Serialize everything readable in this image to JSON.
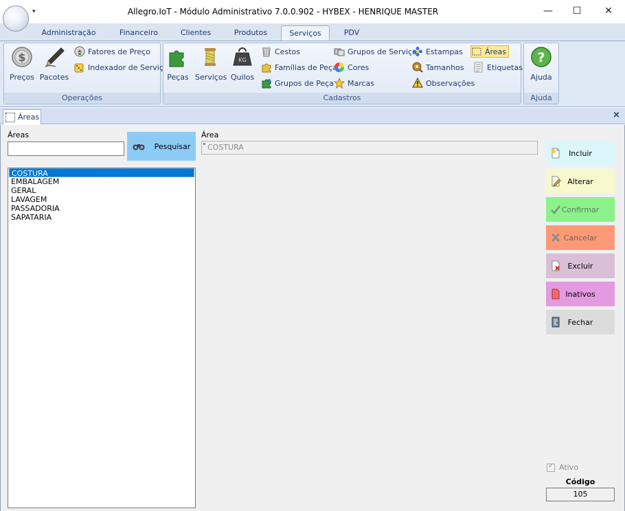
{
  "window": {
    "title": "Allegro.IoT - Módulo Administrativo 7.0.0.902 - HYBEX - HENRIQUE MASTER",
    "minimize": "—",
    "maximize": "☐",
    "close": "✕"
  },
  "ribbon": {
    "tabs": [
      {
        "label": "Administração"
      },
      {
        "label": "Financeiro"
      },
      {
        "label": "Clientes"
      },
      {
        "label": "Produtos"
      },
      {
        "label": "Serviços"
      },
      {
        "label": "PDV"
      }
    ],
    "active_tab": "Serviços",
    "groups": {
      "operacoes": {
        "label": "Operações",
        "precos": "Preços",
        "pacotes": "Pacotes",
        "fatores": "Fatores de Preço",
        "indexador": "Indexador de Serviço"
      },
      "cadastros": {
        "label": "Cadastros",
        "pecas": "Peças",
        "servicos": "Serviços",
        "quilos": "Quilos",
        "cestos": "Cestos",
        "familias": "Famílias de Peça",
        "grupos_peca": "Grupos de Peça",
        "grupos_servico": "Grupos de Serviço",
        "cores": "Cores",
        "marcas": "Marcas",
        "estampas": "Estampas",
        "tamanhos": "Tamanhos",
        "observacoes": "Observações",
        "areas": "Áreas",
        "etiquetas": "Etiquetas"
      },
      "ajuda": {
        "label": "Ajuda",
        "ajuda": "Ajuda"
      }
    }
  },
  "document": {
    "tab_label": "Áreas",
    "close": "×"
  },
  "form": {
    "search_label": "Áreas",
    "search_value": "",
    "search_button": "Pesquisar",
    "area_label": "Área",
    "area_value": "COSTURA",
    "list": [
      "COSTURA",
      "EMBALAGEM",
      "GERAL",
      "LAVAGEM",
      "PASSADORIA",
      "SAPATARIA"
    ],
    "selected_index": 0
  },
  "actions": {
    "incluir": "Incluir",
    "alterar": "Alterar",
    "confirmar": "Confirmar",
    "cancelar": "Cancelar",
    "excluir": "Excluir",
    "inativos": "Inativos",
    "fechar": "Fechar"
  },
  "status": {
    "ativo_label": "Ativo",
    "ativo_checked": true,
    "codigo_label": "Código",
    "codigo_value": "105"
  },
  "colors": {
    "incluir_bg": "#dcf7fb",
    "alterar_bg": "#f8f8cf",
    "confirmar_bg": "#8cf28a",
    "cancelar_bg": "#fc9a78",
    "excluir_bg": "#d9bfd8",
    "inativos_bg": "#e39ae0",
    "fechar_bg": "#dcdcdc",
    "pesquisar_bg": "#8dcbf7",
    "selection": "#0078d7"
  }
}
